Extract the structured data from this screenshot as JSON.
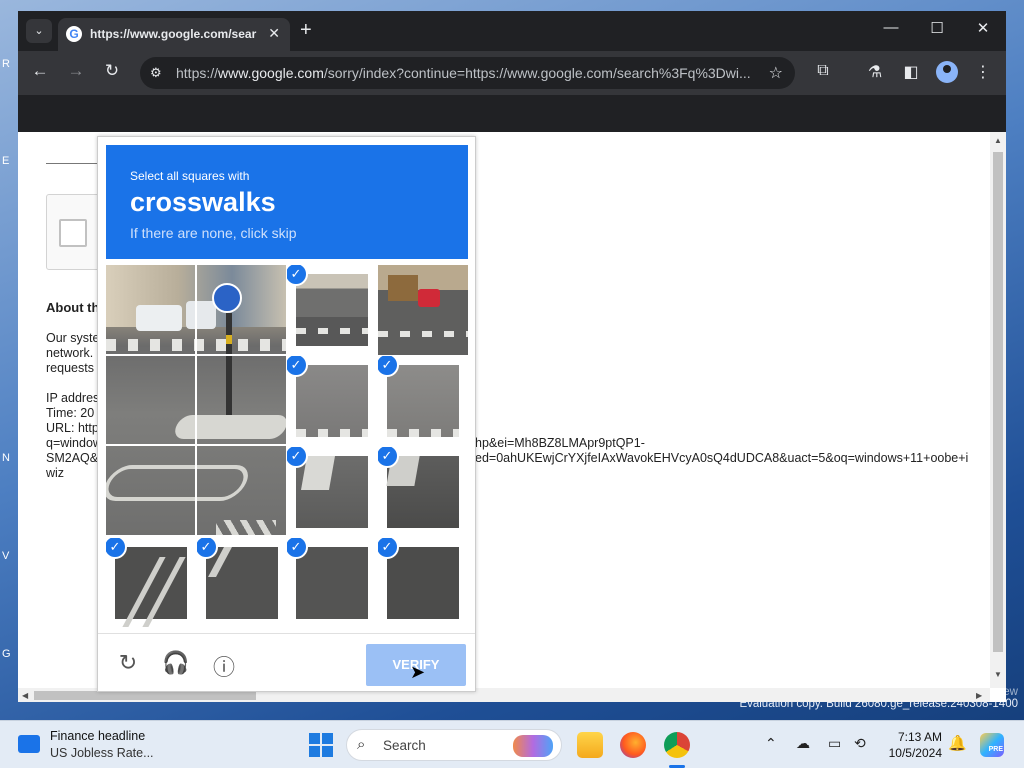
{
  "browser": {
    "tab_title": "https://www.google.com/sear",
    "tab_close": "✕",
    "new_tab": "+",
    "url_scheme": "https://",
    "url_domain": "www.google.com",
    "url_path": "/sorry/index?continue=https://www.google.com/search%3Fq%3Dwi...",
    "win_min": "—",
    "win_max": "☐",
    "win_close": "✕"
  },
  "page": {
    "about_heading": "About th",
    "para1": [
      "Our syste",
      "network.",
      "requests"
    ],
    "para2": [
      "IP addres",
      "Time: 20",
      "URL: http",
      "q=window",
      "SM2AQ&",
      "wiz"
    ],
    "url_tail_1": "hp&ei=Mh8BZ8LMApr9ptQP1-",
    "url_tail_2": "ed=0ahUKEwjCrYXjfeIAxWavokEHVcyA0sQ4dUDCA8&uact=5&oq=windows+11+oobe+i"
  },
  "captcha": {
    "instruction": "Select all squares with",
    "target": "crosswalks",
    "hint": "If there are none, click skip",
    "verify_label": "VERIFY",
    "selected_count": 8
  },
  "desktop": {
    "watermark_1": "new",
    "watermark_2": "Evaluation copy. Build 26080.ge_release.240308-1400"
  },
  "taskbar": {
    "news_title": "Finance headline",
    "news_sub": "US Jobless Rate...",
    "search_placeholder": "Search",
    "time": "7:13 AM",
    "date": "10/5/2024",
    "pre_badge": "PRE"
  },
  "colors": {
    "captcha_header": "#1a73e8",
    "verify_disabled": "#9bc0f5",
    "chrome_dark": "#202124"
  }
}
